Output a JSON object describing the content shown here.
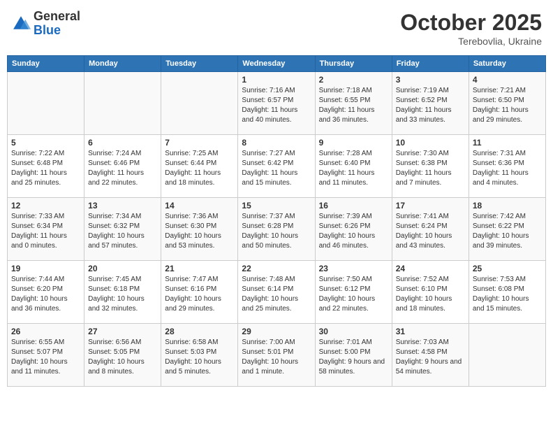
{
  "header": {
    "logo": {
      "general": "General",
      "blue": "Blue"
    },
    "month": "October 2025",
    "location": "Terebovlia, Ukraine"
  },
  "weekdays": [
    "Sunday",
    "Monday",
    "Tuesday",
    "Wednesday",
    "Thursday",
    "Friday",
    "Saturday"
  ],
  "weeks": [
    [
      {
        "day": "",
        "info": ""
      },
      {
        "day": "",
        "info": ""
      },
      {
        "day": "",
        "info": ""
      },
      {
        "day": "1",
        "info": "Sunrise: 7:16 AM\nSunset: 6:57 PM\nDaylight: 11 hours and 40 minutes."
      },
      {
        "day": "2",
        "info": "Sunrise: 7:18 AM\nSunset: 6:55 PM\nDaylight: 11 hours and 36 minutes."
      },
      {
        "day": "3",
        "info": "Sunrise: 7:19 AM\nSunset: 6:52 PM\nDaylight: 11 hours and 33 minutes."
      },
      {
        "day": "4",
        "info": "Sunrise: 7:21 AM\nSunset: 6:50 PM\nDaylight: 11 hours and 29 minutes."
      }
    ],
    [
      {
        "day": "5",
        "info": "Sunrise: 7:22 AM\nSunset: 6:48 PM\nDaylight: 11 hours and 25 minutes."
      },
      {
        "day": "6",
        "info": "Sunrise: 7:24 AM\nSunset: 6:46 PM\nDaylight: 11 hours and 22 minutes."
      },
      {
        "day": "7",
        "info": "Sunrise: 7:25 AM\nSunset: 6:44 PM\nDaylight: 11 hours and 18 minutes."
      },
      {
        "day": "8",
        "info": "Sunrise: 7:27 AM\nSunset: 6:42 PM\nDaylight: 11 hours and 15 minutes."
      },
      {
        "day": "9",
        "info": "Sunrise: 7:28 AM\nSunset: 6:40 PM\nDaylight: 11 hours and 11 minutes."
      },
      {
        "day": "10",
        "info": "Sunrise: 7:30 AM\nSunset: 6:38 PM\nDaylight: 11 hours and 7 minutes."
      },
      {
        "day": "11",
        "info": "Sunrise: 7:31 AM\nSunset: 6:36 PM\nDaylight: 11 hours and 4 minutes."
      }
    ],
    [
      {
        "day": "12",
        "info": "Sunrise: 7:33 AM\nSunset: 6:34 PM\nDaylight: 11 hours and 0 minutes."
      },
      {
        "day": "13",
        "info": "Sunrise: 7:34 AM\nSunset: 6:32 PM\nDaylight: 10 hours and 57 minutes."
      },
      {
        "day": "14",
        "info": "Sunrise: 7:36 AM\nSunset: 6:30 PM\nDaylight: 10 hours and 53 minutes."
      },
      {
        "day": "15",
        "info": "Sunrise: 7:37 AM\nSunset: 6:28 PM\nDaylight: 10 hours and 50 minutes."
      },
      {
        "day": "16",
        "info": "Sunrise: 7:39 AM\nSunset: 6:26 PM\nDaylight: 10 hours and 46 minutes."
      },
      {
        "day": "17",
        "info": "Sunrise: 7:41 AM\nSunset: 6:24 PM\nDaylight: 10 hours and 43 minutes."
      },
      {
        "day": "18",
        "info": "Sunrise: 7:42 AM\nSunset: 6:22 PM\nDaylight: 10 hours and 39 minutes."
      }
    ],
    [
      {
        "day": "19",
        "info": "Sunrise: 7:44 AM\nSunset: 6:20 PM\nDaylight: 10 hours and 36 minutes."
      },
      {
        "day": "20",
        "info": "Sunrise: 7:45 AM\nSunset: 6:18 PM\nDaylight: 10 hours and 32 minutes."
      },
      {
        "day": "21",
        "info": "Sunrise: 7:47 AM\nSunset: 6:16 PM\nDaylight: 10 hours and 29 minutes."
      },
      {
        "day": "22",
        "info": "Sunrise: 7:48 AM\nSunset: 6:14 PM\nDaylight: 10 hours and 25 minutes."
      },
      {
        "day": "23",
        "info": "Sunrise: 7:50 AM\nSunset: 6:12 PM\nDaylight: 10 hours and 22 minutes."
      },
      {
        "day": "24",
        "info": "Sunrise: 7:52 AM\nSunset: 6:10 PM\nDaylight: 10 hours and 18 minutes."
      },
      {
        "day": "25",
        "info": "Sunrise: 7:53 AM\nSunset: 6:08 PM\nDaylight: 10 hours and 15 minutes."
      }
    ],
    [
      {
        "day": "26",
        "info": "Sunrise: 6:55 AM\nSunset: 5:07 PM\nDaylight: 10 hours and 11 minutes."
      },
      {
        "day": "27",
        "info": "Sunrise: 6:56 AM\nSunset: 5:05 PM\nDaylight: 10 hours and 8 minutes."
      },
      {
        "day": "28",
        "info": "Sunrise: 6:58 AM\nSunset: 5:03 PM\nDaylight: 10 hours and 5 minutes."
      },
      {
        "day": "29",
        "info": "Sunrise: 7:00 AM\nSunset: 5:01 PM\nDaylight: 10 hours and 1 minute."
      },
      {
        "day": "30",
        "info": "Sunrise: 7:01 AM\nSunset: 5:00 PM\nDaylight: 9 hours and 58 minutes."
      },
      {
        "day": "31",
        "info": "Sunrise: 7:03 AM\nSunset: 4:58 PM\nDaylight: 9 hours and 54 minutes."
      },
      {
        "day": "",
        "info": ""
      }
    ]
  ]
}
